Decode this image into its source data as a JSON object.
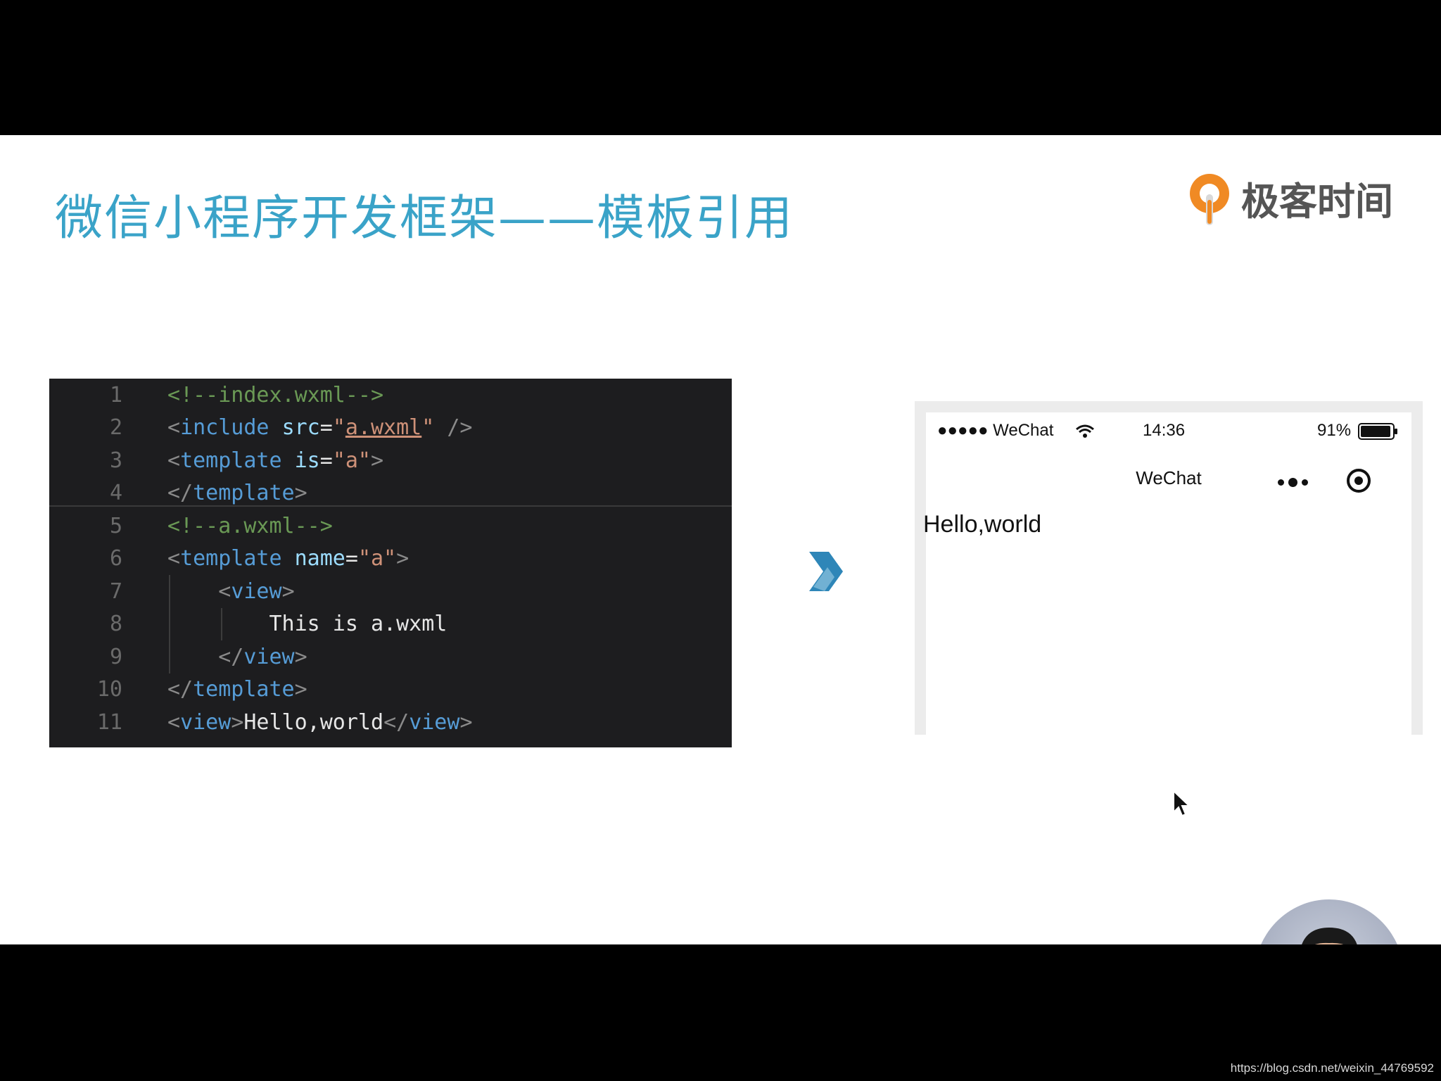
{
  "slide": {
    "title": "微信小程序开发框架——模板引用",
    "logo_text": "极客时间"
  },
  "code_panel": {
    "lines": [
      {
        "num": "1",
        "tokens": [
          {
            "t": "cm",
            "v": "<!--index.wxml-->"
          }
        ]
      },
      {
        "num": "2",
        "tokens": [
          {
            "t": "pn",
            "v": "<"
          },
          {
            "t": "tg",
            "v": "include"
          },
          {
            "t": "tx",
            "v": " "
          },
          {
            "t": "at",
            "v": "src"
          },
          {
            "t": "tx",
            "v": "="
          },
          {
            "t": "st",
            "v": "\""
          },
          {
            "t": "stu",
            "v": "a.wxml"
          },
          {
            "t": "st",
            "v": "\""
          },
          {
            "t": "tx",
            "v": " "
          },
          {
            "t": "pn",
            "v": "/>"
          }
        ]
      },
      {
        "num": "3",
        "tokens": [
          {
            "t": "pn",
            "v": "<"
          },
          {
            "t": "tg",
            "v": "template"
          },
          {
            "t": "tx",
            "v": " "
          },
          {
            "t": "at",
            "v": "is"
          },
          {
            "t": "tx",
            "v": "="
          },
          {
            "t": "st",
            "v": "\"a\""
          },
          {
            "t": "pn",
            "v": ">"
          }
        ]
      },
      {
        "num": "4",
        "tokens": [
          {
            "t": "pn",
            "v": "</"
          },
          {
            "t": "tg",
            "v": "template"
          },
          {
            "t": "pn",
            "v": ">"
          }
        ]
      },
      {
        "num": "5",
        "tokens": [
          {
            "t": "cm",
            "v": "<!--a.wxml-->"
          }
        ]
      },
      {
        "num": "6",
        "tokens": [
          {
            "t": "pn",
            "v": "<"
          },
          {
            "t": "tg",
            "v": "template"
          },
          {
            "t": "tx",
            "v": " "
          },
          {
            "t": "at",
            "v": "name"
          },
          {
            "t": "tx",
            "v": "="
          },
          {
            "t": "st",
            "v": "\"a\""
          },
          {
            "t": "pn",
            "v": ">"
          }
        ]
      },
      {
        "num": "7",
        "tokens": [
          {
            "t": "tx",
            "v": "    "
          },
          {
            "t": "pn",
            "v": "<"
          },
          {
            "t": "tg",
            "v": "view"
          },
          {
            "t": "pn",
            "v": ">"
          }
        ]
      },
      {
        "num": "8",
        "tokens": [
          {
            "t": "tx",
            "v": "        This is a.wxml"
          }
        ]
      },
      {
        "num": "9",
        "tokens": [
          {
            "t": "tx",
            "v": "    "
          },
          {
            "t": "pn",
            "v": "</"
          },
          {
            "t": "tg",
            "v": "view"
          },
          {
            "t": "pn",
            "v": ">"
          }
        ]
      },
      {
        "num": "10",
        "tokens": [
          {
            "t": "pn",
            "v": "</"
          },
          {
            "t": "tg",
            "v": "template"
          },
          {
            "t": "pn",
            "v": ">"
          }
        ]
      },
      {
        "num": "11",
        "tokens": [
          {
            "t": "pn",
            "v": "<"
          },
          {
            "t": "tg",
            "v": "view"
          },
          {
            "t": "pn",
            "v": ">"
          },
          {
            "t": "tx",
            "v": "Hello,world"
          },
          {
            "t": "pn",
            "v": "</"
          },
          {
            "t": "tg",
            "v": "view"
          },
          {
            "t": "pn",
            "v": ">"
          }
        ]
      }
    ]
  },
  "phone": {
    "carrier": "●●●●● WeChat",
    "time": "14:36",
    "battery": "91%",
    "nav_title": "WeChat",
    "content": "Hello,world"
  },
  "icons": {
    "arrow": "chevron-right-icon",
    "wifi": "wifi-icon",
    "battery": "battery-icon",
    "more": "more-dots-icon",
    "close": "target-close-icon",
    "cursor": "mouse-cursor-icon"
  },
  "watermark": "https://blog.csdn.net/weixin_44769592",
  "colors": {
    "title": "#3aa3c8",
    "code_bg": "#1d1d1f",
    "accent_arrow": "#2e86b8",
    "logo_orange": "#f08a24"
  }
}
